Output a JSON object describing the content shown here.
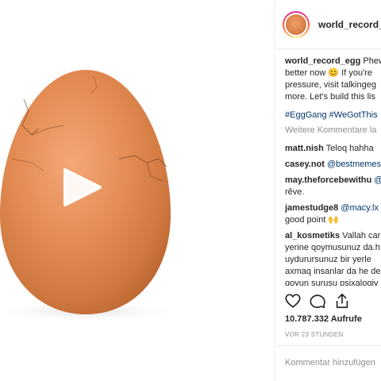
{
  "post": {
    "username": "world_record_egg"
  },
  "caption": {
    "username": "world_record_egg",
    "lines": [
      "Phew",
      "better now 😊 If you're",
      "pressure, visit talkingeg",
      "more. Let's build this lis"
    ],
    "hashtags": "#EggGang #WeGotThis"
  },
  "more_comments": "Weitere Kommentare la",
  "comments": [
    {
      "username": "matt.nish",
      "text": "Teloq hahha"
    },
    {
      "username": "casey.not",
      "text": "@bestmemes"
    },
    {
      "username": "may.theforcebewithu",
      "text": "@",
      "line2": "rêve."
    },
    {
      "username": "jamestudge8",
      "text": "@macy.lx",
      "line2": "good point 🙌"
    },
    {
      "username": "al_kosmetiks",
      "text": "Vallah car",
      "lines": [
        "yerine qoymusunuz da.h",
        "uydurursunuz bir yerle",
        "axmaq insanlar da he de",
        "qoyun surusu psixalogiy"
      ]
    }
  ],
  "actions": {
    "likes": "10.787.332 Aufrufe",
    "timestamp": "VOR 23 STUNDEN",
    "add_comment_placeholder": "Kommentar hinzufügen"
  },
  "colors": {
    "link": "#003569",
    "muted": "#8e8e8e",
    "text": "#262626"
  }
}
